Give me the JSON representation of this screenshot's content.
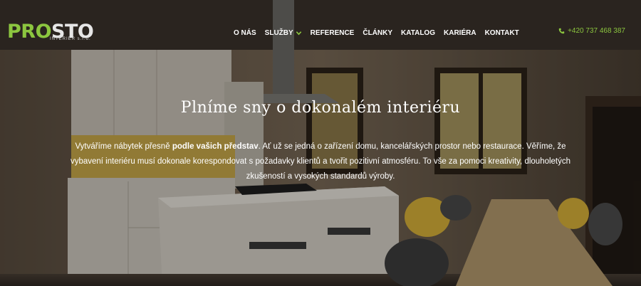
{
  "brand": {
    "logo_part1": "PRO",
    "logo_part2": "STO",
    "tagline": "INTERIÉR s.r.o.",
    "accent_color": "#8cc63f"
  },
  "nav": {
    "items": [
      {
        "label": "O NÁS"
      },
      {
        "label": "SLUŽBY",
        "has_dropdown": true
      },
      {
        "label": "REFERENCE"
      },
      {
        "label": "ČLÁNKY"
      },
      {
        "label": "KATALOG"
      },
      {
        "label": "KARIÉRA"
      },
      {
        "label": "KONTAKT"
      }
    ]
  },
  "contact": {
    "phone": "+420 737 468 387",
    "icon": "phone-icon"
  },
  "hero": {
    "headline": "Plníme sny o dokonalém interiéru",
    "intro_part1": "Vytváříme nábytek přesně ",
    "intro_bold": "podle vašich představ",
    "intro_part2": ". Ať už se jedná o zařízení domu, kancelářských prostor nebo restaurace. Věříme, že vybavení interiéru musí dokonale korespondovat s požadavky klientů a tvořit pozitivní atmosféru. To vše za pomoci kreativity, dlouholetých zkušeností a vysokých standardů výroby."
  }
}
